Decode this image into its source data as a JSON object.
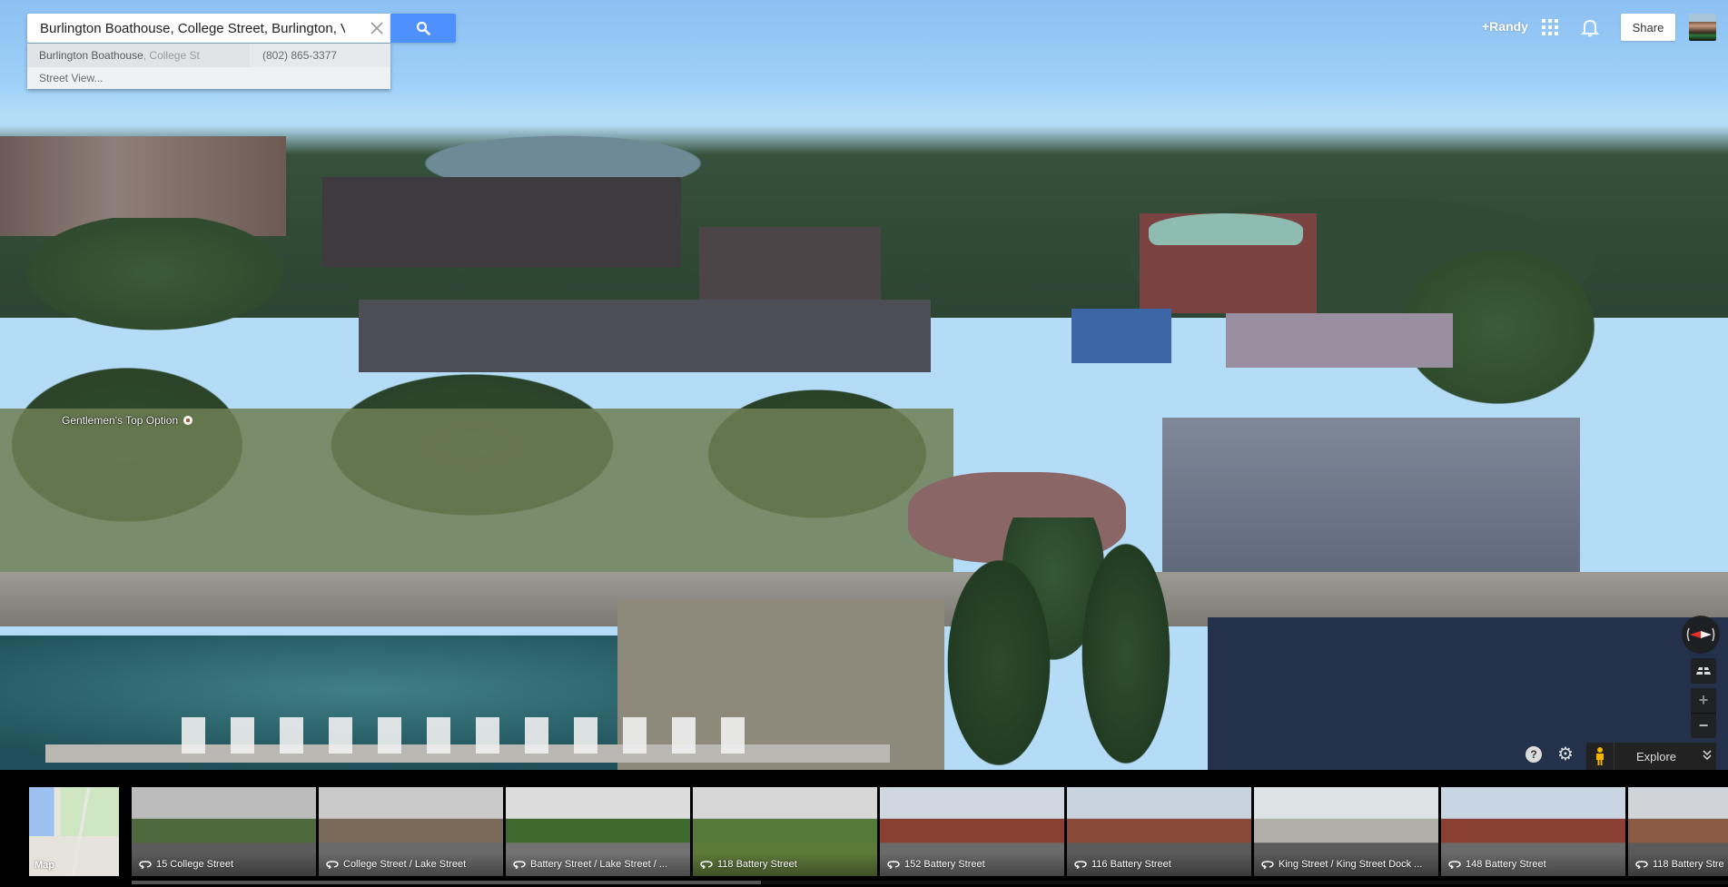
{
  "search": {
    "query": "Burlington Boathouse, College Street, Burlington, VT",
    "clear_icon": "close-icon",
    "button_icon": "search-icon",
    "accent": "#4d90fe"
  },
  "suggestions": [
    {
      "name": "Burlington Boathouse",
      "detail": ", College St",
      "phone": "(802) 865-3377"
    },
    {
      "name": "Street View..."
    }
  ],
  "header": {
    "user_link": "+Randy",
    "apps_icon": "apps-grid-icon",
    "notifications_icon": "bell-icon",
    "share_label": "Share",
    "avatar_icon": "user-avatar"
  },
  "map_labels": [
    {
      "text": "Gentlemen's Top Option",
      "icon": "place-pin-icon"
    }
  ],
  "controls": {
    "compass_icon": "compass-icon",
    "tilt_icon": "tilt-3d-icon",
    "zoom_in": "+",
    "zoom_out": "−",
    "help": "?",
    "settings_icon": "gear-icon",
    "pegman_icon": "pegman-icon",
    "explore_label": "Explore",
    "explore_chevron": "»"
  },
  "bottom_strip": {
    "map_label": "Map",
    "photo_icon": "360-rotate-icon",
    "photos": [
      {
        "caption": "15 College Street"
      },
      {
        "caption": "College Street / Lake Street"
      },
      {
        "caption": "Battery Street / Lake Street / ..."
      },
      {
        "caption": "118 Battery Street"
      },
      {
        "caption": "152 Battery Street"
      },
      {
        "caption": "116 Battery Street"
      },
      {
        "caption": "King Street / King Street Dock ..."
      },
      {
        "caption": "148 Battery Street"
      },
      {
        "caption": "118 Battery Stre"
      }
    ],
    "scroll_position": 0.39
  }
}
